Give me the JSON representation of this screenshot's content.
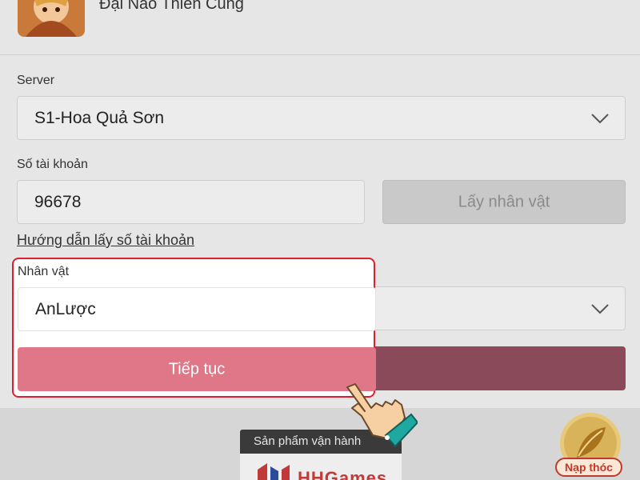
{
  "header": {
    "game_title": "Đại Náo Thiên Cung",
    "game_icon": "game-avatar-icon"
  },
  "form": {
    "server_label": "Server",
    "server_value": "S1-Hoa Quả Sơn",
    "account_label": "Số tài khoản",
    "account_value": "96678",
    "get_character_button": "Lấy nhân vật",
    "help_link": "Hướng dẫn lấy số tài khoản",
    "character_label": "Nhân vật",
    "character_value": "AnLược",
    "continue_button": "Tiếp tục"
  },
  "footer": {
    "publisher_tag": "Sản phẩm vận hành",
    "publisher_logo": "HHGames",
    "topup_label": "Nạp thóc"
  },
  "colors": {
    "highlight_border": "#e01e2e",
    "continue_button": "#e07788",
    "topup_accent": "#c0392b"
  }
}
